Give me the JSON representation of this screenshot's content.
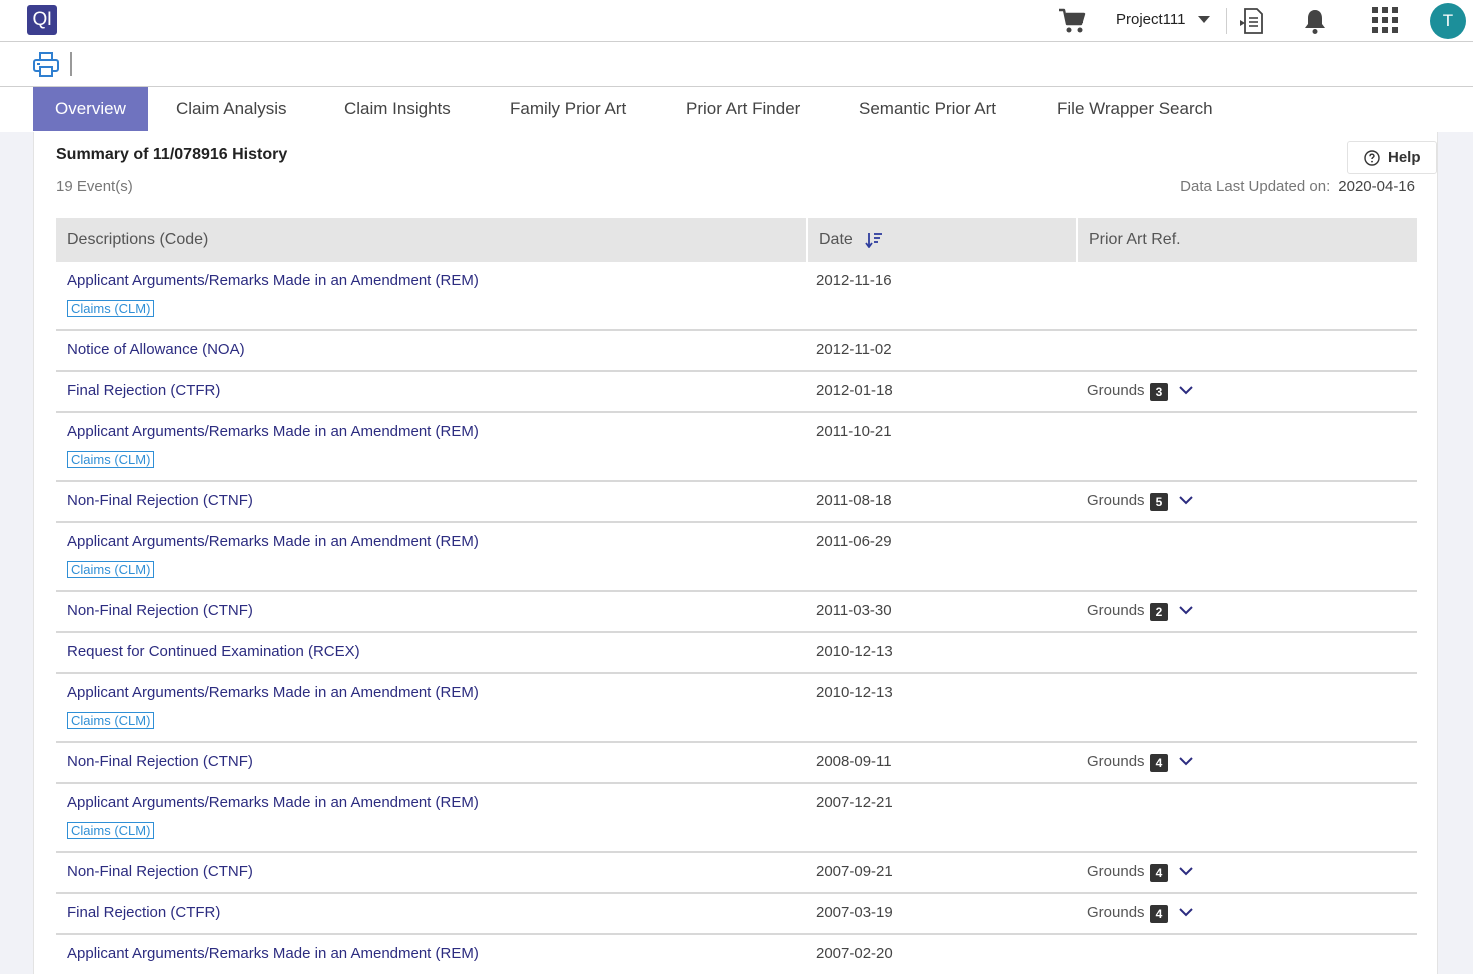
{
  "app": {
    "logo_text": "QI",
    "avatar_initial": "T",
    "brand_color": "#3c3e8f",
    "accent_color": "#6f73bf"
  },
  "header": {
    "project": "Project111"
  },
  "tabs": [
    {
      "label": "Overview",
      "active": true
    },
    {
      "label": "Claim Analysis",
      "active": false
    },
    {
      "label": "Claim Insights",
      "active": false
    },
    {
      "label": "Family Prior Art",
      "active": false
    },
    {
      "label": "Prior Art Finder",
      "active": false
    },
    {
      "label": "Semantic Prior Art",
      "active": false
    },
    {
      "label": "File Wrapper Search",
      "active": false
    }
  ],
  "summary": {
    "title": "Summary of 11/078916 History",
    "event_count": "19 Event(s)",
    "help_label": "Help",
    "updated_label": "Data Last Updated on:",
    "updated_value": "2020-04-16"
  },
  "table": {
    "headers": {
      "description": "Descriptions (Code)",
      "date": "Date",
      "prior_art": "Prior Art Ref."
    },
    "grounds_label": "Grounds",
    "rows": [
      {
        "description": "Applicant Arguments/Remarks Made in an Amendment (REM)",
        "tag": "Claims (CLM)",
        "date": "2012-11-16",
        "grounds": null
      },
      {
        "description": "Notice of Allowance (NOA)",
        "tag": null,
        "date": "2012-11-02",
        "grounds": null
      },
      {
        "description": "Final Rejection (CTFR)",
        "tag": null,
        "date": "2012-01-18",
        "grounds": 3
      },
      {
        "description": "Applicant Arguments/Remarks Made in an Amendment (REM)",
        "tag": "Claims (CLM)",
        "date": "2011-10-21",
        "grounds": null
      },
      {
        "description": "Non-Final Rejection (CTNF)",
        "tag": null,
        "date": "2011-08-18",
        "grounds": 5
      },
      {
        "description": "Applicant Arguments/Remarks Made in an Amendment (REM)",
        "tag": "Claims (CLM)",
        "date": "2011-06-29",
        "grounds": null
      },
      {
        "description": "Non-Final Rejection (CTNF)",
        "tag": null,
        "date": "2011-03-30",
        "grounds": 2
      },
      {
        "description": "Request for Continued Examination (RCEX)",
        "tag": null,
        "date": "2010-12-13",
        "grounds": null
      },
      {
        "description": "Applicant Arguments/Remarks Made in an Amendment (REM)",
        "tag": "Claims (CLM)",
        "date": "2010-12-13",
        "grounds": null
      },
      {
        "description": "Non-Final Rejection (CTNF)",
        "tag": null,
        "date": "2008-09-11",
        "grounds": 4
      },
      {
        "description": "Applicant Arguments/Remarks Made in an Amendment (REM)",
        "tag": "Claims (CLM)",
        "date": "2007-12-21",
        "grounds": null
      },
      {
        "description": "Non-Final Rejection (CTNF)",
        "tag": null,
        "date": "2007-09-21",
        "grounds": 4
      },
      {
        "description": "Final Rejection (CTFR)",
        "tag": null,
        "date": "2007-03-19",
        "grounds": 4
      },
      {
        "description": "Applicant Arguments/Remarks Made in an Amendment (REM)",
        "tag": null,
        "date": "2007-02-20",
        "grounds": null
      }
    ]
  }
}
